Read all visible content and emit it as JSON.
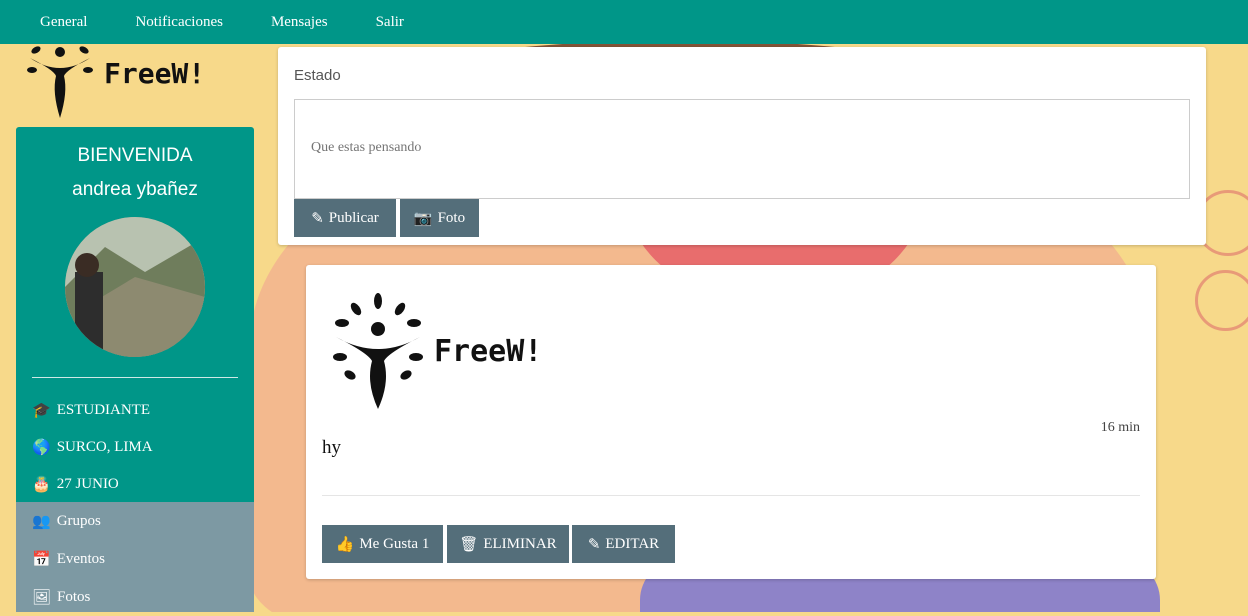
{
  "nav": {
    "items": [
      "General",
      "Notificaciones",
      "Mensajes",
      "Salir"
    ]
  },
  "logo": {
    "text": "FreeW!"
  },
  "sidebar": {
    "welcome": "BIENVENIDA",
    "username": "andrea ybañez",
    "info": [
      {
        "icon": "graduation-cap-icon",
        "label": "ESTUDIANTE"
      },
      {
        "icon": "globe-icon",
        "label": "SURCO, LIMA"
      },
      {
        "icon": "birthday-cake-icon",
        "label": "27 JUNIO"
      }
    ],
    "menu": [
      {
        "icon": "users-icon",
        "label": "Grupos"
      },
      {
        "icon": "calendar-icon",
        "label": "Eventos"
      },
      {
        "icon": "image-icon",
        "label": "Fotos"
      }
    ]
  },
  "status": {
    "label": "Estado",
    "placeholder": "Que estas pensando",
    "publish_label": "Publicar",
    "photo_label": "Foto"
  },
  "post": {
    "logo_text": "FreeW!",
    "time": "16 min",
    "text": "hy",
    "like_label": "Me Gusta 1",
    "delete_label": "ELIMINAR",
    "edit_label": "EDITAR"
  },
  "colors": {
    "primary": "#009688",
    "button": "#546e7a",
    "menu_bg": "#7d99a3"
  }
}
